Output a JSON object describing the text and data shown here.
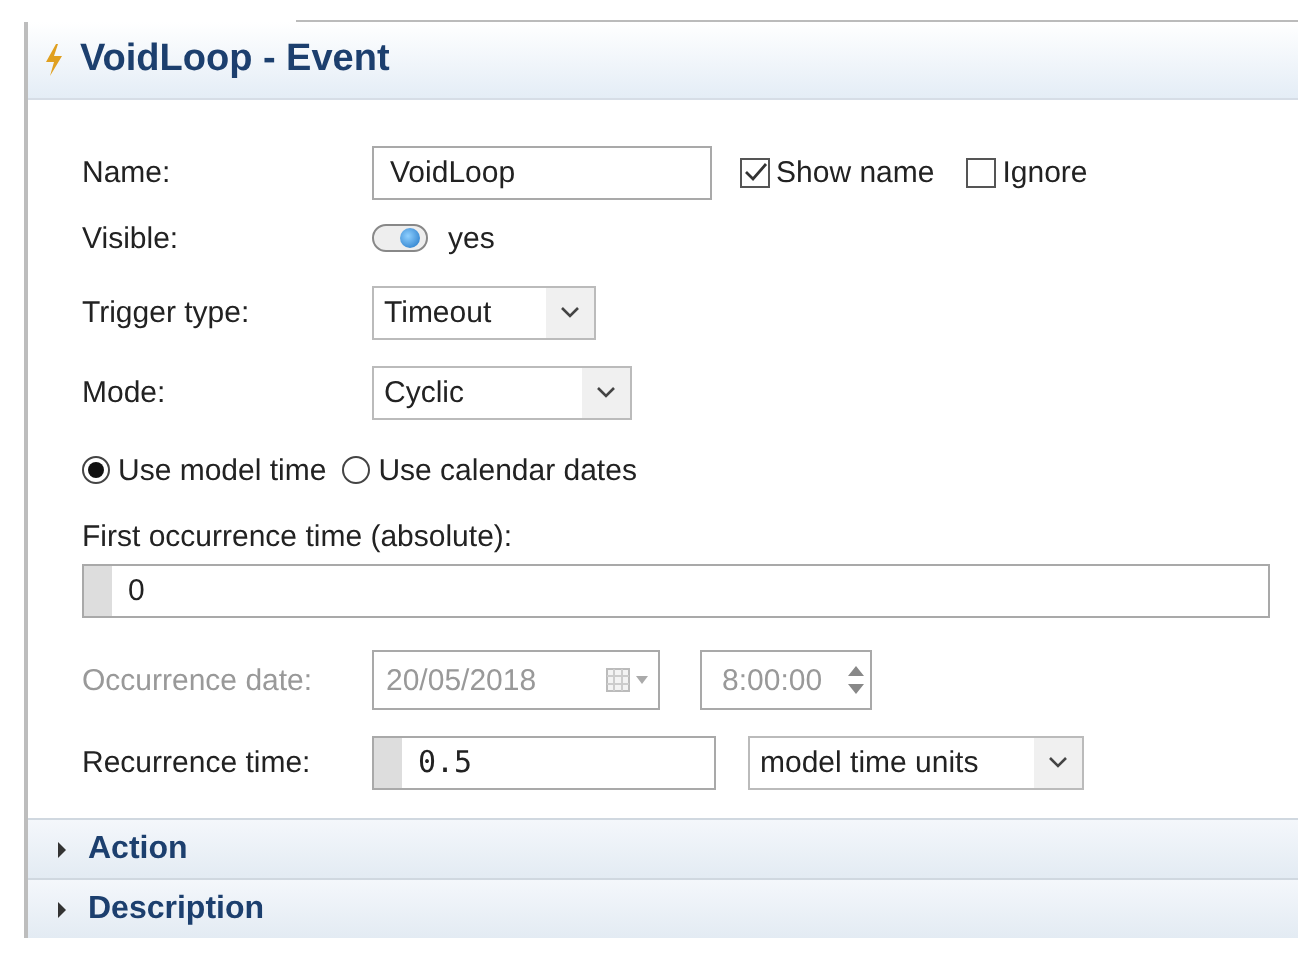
{
  "panel": {
    "title": "VoidLoop - Event"
  },
  "name": {
    "label": "Name:",
    "value": "VoidLoop"
  },
  "show_name": {
    "label": "Show name",
    "checked": true
  },
  "ignore": {
    "label": "Ignore",
    "checked": false
  },
  "visible": {
    "label": "Visible:",
    "on": true,
    "value": "yes"
  },
  "trigger_type": {
    "label": "Trigger type:",
    "value": "Timeout"
  },
  "mode": {
    "label": "Mode:",
    "value": "Cyclic"
  },
  "time_source": [
    {
      "label": "Use model time",
      "selected": true
    },
    {
      "label": "Use calendar dates",
      "selected": false
    }
  ],
  "first_occurrence": {
    "label": "First occurrence time (absolute):",
    "value": "0"
  },
  "occurrence_date": {
    "label": "Occurrence date:",
    "date": "20/05/2018",
    "time": "8:00:00",
    "disabled": true
  },
  "recurrence": {
    "label": "Recurrence time:",
    "value": "0.5",
    "unit": "model time units"
  },
  "sections": [
    {
      "label": "Action",
      "expanded": false
    },
    {
      "label": "Description",
      "expanded": false
    }
  ]
}
